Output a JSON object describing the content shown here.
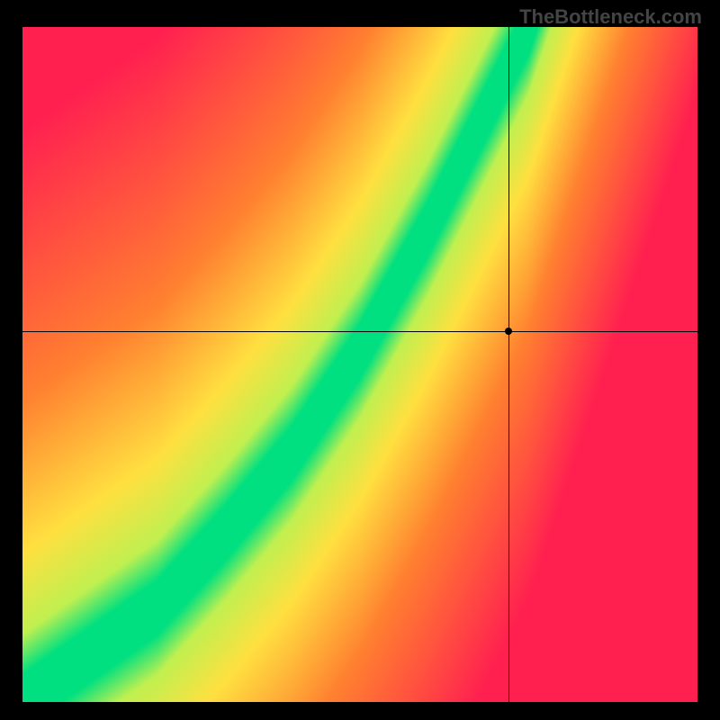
{
  "watermark": "TheBottleneck.com",
  "chart_data": {
    "type": "heatmap",
    "title": "",
    "xlabel": "",
    "ylabel": "",
    "xlim": [
      0,
      1
    ],
    "ylim": [
      0,
      1
    ],
    "marker": {
      "x": 0.72,
      "y": 0.55
    },
    "crosshair": {
      "x": 0.72,
      "y": 0.55
    },
    "colorscale_note": "red=worst, yellow=mid, green=ideal; diagonal green band from bottom-left to upper-center",
    "ideal_curve_points": [
      {
        "x": 0.0,
        "y": 0.0
      },
      {
        "x": 0.1,
        "y": 0.07
      },
      {
        "x": 0.2,
        "y": 0.14
      },
      {
        "x": 0.3,
        "y": 0.25
      },
      {
        "x": 0.4,
        "y": 0.37
      },
      {
        "x": 0.5,
        "y": 0.52
      },
      {
        "x": 0.6,
        "y": 0.7
      },
      {
        "x": 0.7,
        "y": 0.9
      },
      {
        "x": 0.75,
        "y": 1.0
      }
    ],
    "band_width_estimate": 0.06,
    "corner_colors_estimate": {
      "top_left": "#ff1744",
      "top_right": "#ffeb3b",
      "bottom_left": "#ff1744",
      "bottom_right": "#ff1744",
      "band": "#00e676"
    }
  }
}
